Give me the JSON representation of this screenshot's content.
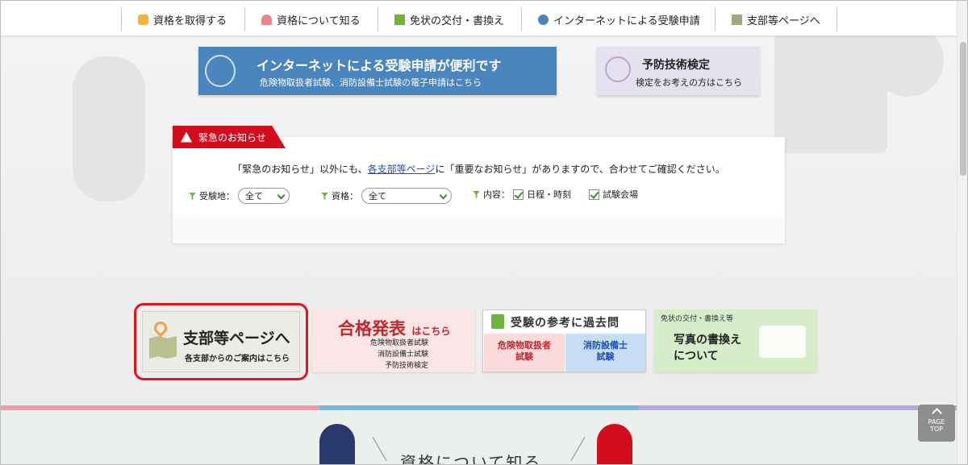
{
  "nav": {
    "items": [
      {
        "label": "資格を取得する",
        "icon": "hand-icon",
        "icon_color": "#f3b43c"
      },
      {
        "label": "資格について知る",
        "icon": "people-icon",
        "icon_color": "#e8868c"
      },
      {
        "label": "免状の交付・書換え",
        "icon": "license-card-icon",
        "icon_color": "#6fb43a"
      },
      {
        "label": "インターネットによる受験申請",
        "icon": "computer-icon",
        "icon_color": "#4a85bd"
      },
      {
        "label": "支部等ページへ",
        "icon": "map-icon",
        "icon_color": "#a3a97f"
      }
    ]
  },
  "banners": {
    "internet": {
      "title": "インターネットによる受験申請が便利です",
      "sub": "危険物取扱者試験、消防設備士試験の電子申請はこちら",
      "color": "#4a85bd"
    },
    "prevention": {
      "title": "予防技術検定",
      "sub": "検定をお考えの方はこちら",
      "color": "#e6e1ef"
    }
  },
  "notice": {
    "tab_label": "緊急のお知らせ",
    "text_before": "「緊急のお知らせ」以外にも、",
    "link_text": "各支部等ページ",
    "text_after": "に「重要なお知らせ」がありますので、合わせてご確認ください。",
    "filters": {
      "location_label": "受験地：",
      "location_value": "全て",
      "qualification_label": "資格：",
      "qualification_value": "全て",
      "content_label": "内容：",
      "check_schedule": "日程・時刻",
      "check_venue": "試験会場"
    },
    "accent": "#d40d1e"
  },
  "cards": {
    "branch": {
      "title": "支部等ページへ",
      "sub": "各支部からのご案内はこちら"
    },
    "result": {
      "title": "合格発表",
      "title_small": "はこちら",
      "lines": [
        "危険物取扱者試験",
        "消防設備士試験",
        "予防技術検定"
      ]
    },
    "past": {
      "title": "受験の参考に過去問",
      "left": [
        "危険物取扱者",
        "試験"
      ],
      "right": [
        "消防設備士",
        "試験"
      ]
    },
    "photo": {
      "tag": "免状の交付・書換え等",
      "title_lines": [
        "写真の書換え",
        "について"
      ]
    }
  },
  "bottom": {
    "section_title": "資格について知る"
  },
  "pagetop": {
    "line1": "PAGE",
    "line2": "TOP"
  }
}
